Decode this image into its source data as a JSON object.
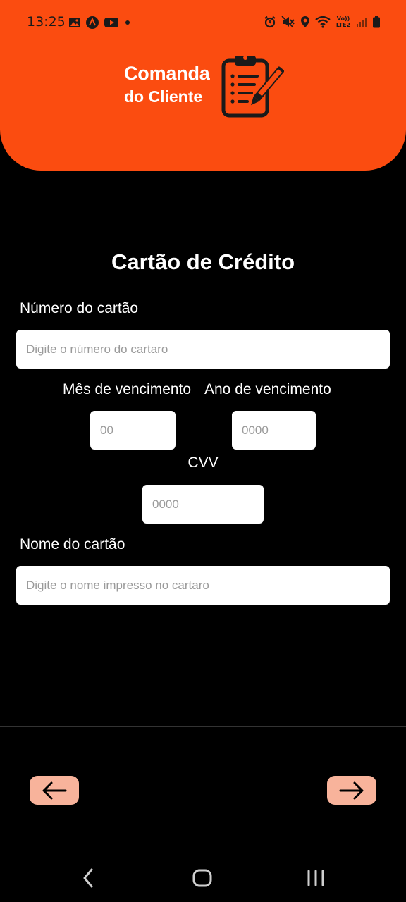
{
  "status_bar": {
    "time": "13:25",
    "left_icons": [
      "image-icon",
      "app-a-icon",
      "youtube-icon",
      "dot-icon"
    ],
    "right_icons": [
      "alarm-icon",
      "mute-icon",
      "location-icon",
      "wifi-icon",
      "lte-icon",
      "signal-icon",
      "battery-icon"
    ],
    "lte_label": "Vo)) LTE2"
  },
  "header": {
    "title": "Comanda",
    "subtitle": "do Cliente",
    "icon": "clipboard-pen-icon",
    "background": "#FB4C10"
  },
  "form": {
    "title": "Cartão de Crédito",
    "card_number_label": "Número do cartão",
    "card_number_placeholder": "Digite o número do cartaro",
    "card_number_value": "",
    "expiry_month_label": "Mês de vencimento",
    "expiry_month_placeholder": "00",
    "expiry_year_label": "Ano de vencimento",
    "expiry_year_placeholder": "0000",
    "cvv_label": "CVV",
    "cvv_placeholder": "0000",
    "card_name_label": "Nome do cartão",
    "card_name_placeholder": "Digite o nome impresso no cartaro",
    "card_name_value": ""
  },
  "navigation": {
    "back_icon": "arrow-left-icon",
    "next_icon": "arrow-right-icon",
    "button_color": "#F8B39B"
  },
  "system_nav": {
    "icons": [
      "back-chevron-icon",
      "home-icon",
      "recents-icon"
    ]
  }
}
